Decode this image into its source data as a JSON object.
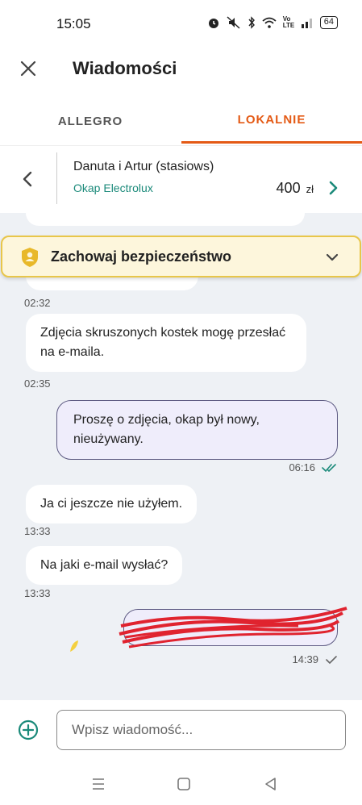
{
  "status_bar": {
    "time": "15:05",
    "battery": "64",
    "network_label": "Vo LTE",
    "icons": [
      "alarm-icon",
      "mute-icon",
      "bluetooth-icon",
      "wifi-icon",
      "signal-icon",
      "battery-icon"
    ]
  },
  "header": {
    "title": "Wiadomości",
    "close_icon": "close-icon"
  },
  "tabs": [
    {
      "label": "ALLEGRO",
      "active": false
    },
    {
      "label": "LOKALNIE",
      "active": true
    }
  ],
  "offer": {
    "seller": "Danuta i Artur (stasiows)",
    "title": "Okap Electrolux",
    "price": "400",
    "currency": "zł"
  },
  "safety_banner": {
    "label": "Zachowaj bezpieczeństwo"
  },
  "messages": [
    {
      "direction": "in",
      "text": "",
      "time": "02:32"
    },
    {
      "direction": "in",
      "text": "Zdjęcia skruszonych kostek mogę przesłać na e-maila.",
      "time": "02:35"
    },
    {
      "direction": "out",
      "text": "Proszę o zdjęcia, okap był nowy, nieużywany.",
      "time": "06:16",
      "read": true
    },
    {
      "direction": "in",
      "text": "Ja ci jeszcze nie użyłem.",
      "time": "13:33"
    },
    {
      "direction": "in",
      "text": "Na jaki e-mail wysłać?",
      "time": "13:33"
    },
    {
      "direction": "out",
      "text": "",
      "time": "14:39",
      "read": false,
      "redacted": true
    }
  ],
  "composer": {
    "placeholder": "Wpisz wiadomość..."
  },
  "colors": {
    "accent": "#e45a15",
    "teal": "#1b8a7a",
    "chat_bg": "#eef1f5",
    "outgoing_bg": "#efedfb",
    "banner_bg": "#fdf6dc",
    "banner_border": "#e8c64a",
    "redaction": "#e0232f"
  }
}
